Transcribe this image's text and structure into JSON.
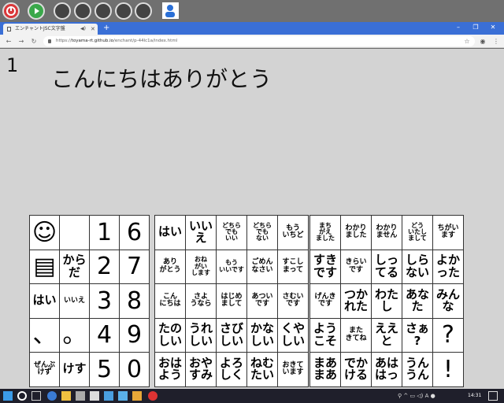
{
  "launcher": {
    "buttons": [
      {
        "name": "power",
        "color": "#d9383a"
      },
      {
        "name": "play",
        "color": "#3aa84a"
      },
      {
        "name": "mouse",
        "color": "#444444"
      },
      {
        "name": "mouse",
        "color": "#444444"
      },
      {
        "name": "mouse",
        "color": "#444444"
      },
      {
        "name": "mouse-plus",
        "color": "#444444"
      },
      {
        "name": "mouse-minus",
        "color": "#444444"
      }
    ],
    "user_icon": "user-icon"
  },
  "browser": {
    "tab_title": "エンチャントJSC文字盤",
    "url_scheme": "https://",
    "url_domain": "toyama-rt.github.io",
    "url_path": "/enchant/p-44lc1a/index.html"
  },
  "page": {
    "count": "1",
    "message": "こんにちはありがとう"
  },
  "grid1": [
    [
      "☺",
      "",
      "1",
      "6"
    ],
    [
      "▤",
      "から\nだ",
      "2",
      "7"
    ],
    [
      "はい",
      "いいえ",
      "3",
      "8"
    ],
    [
      "、",
      "。",
      "4",
      "9"
    ],
    [
      "ぜんぶ\nけず",
      "けす",
      "5",
      "0"
    ]
  ],
  "grid2": [
    [
      "はい",
      "いい\nえ",
      "どちら\nでも\nいい",
      "どちら\nでも\nない",
      "もう\nいちど"
    ],
    [
      "あり\nがとう",
      "おね\nがい\nします",
      "もう\nいいです",
      "ごめん\nなさい",
      "すこし\nまって"
    ],
    [
      "こん\nにちは",
      "さよ\nうなら",
      "はじめ\nまして",
      "あつい\nです",
      "さむい\nです"
    ],
    [
      "たの\nしい",
      "うれ\nしい",
      "さび\nしい",
      "かな\nしい",
      "くや\nしい"
    ],
    [
      "おは\nよう",
      "おや\nすみ",
      "よろ\nしく",
      "ねむ\nたい",
      "おきて\nいます"
    ]
  ],
  "grid3": [
    [
      "まち\nがえ\nました",
      "わかり\nました",
      "わかり\nません",
      "どう\nいたし\nまして",
      "ちがい\nます"
    ],
    [
      "すき\nです",
      "きらい\nです",
      "しっ\nてる",
      "しら\nない",
      "よか\nった"
    ],
    [
      "げんき\nです",
      "つか\nれた",
      "わた\nし",
      "あな\nた",
      "みん\nな"
    ],
    [
      "よう\nこそ",
      "また\nきてね",
      "ええ\nと",
      "さぁ\n?",
      "?"
    ],
    [
      "まあ\nまあ",
      "でか\nける",
      "あは\nはっ",
      "うん\nうん",
      "!"
    ]
  ],
  "taskbar": {
    "clock": "14:31",
    "bg": "#1f1f2b"
  }
}
